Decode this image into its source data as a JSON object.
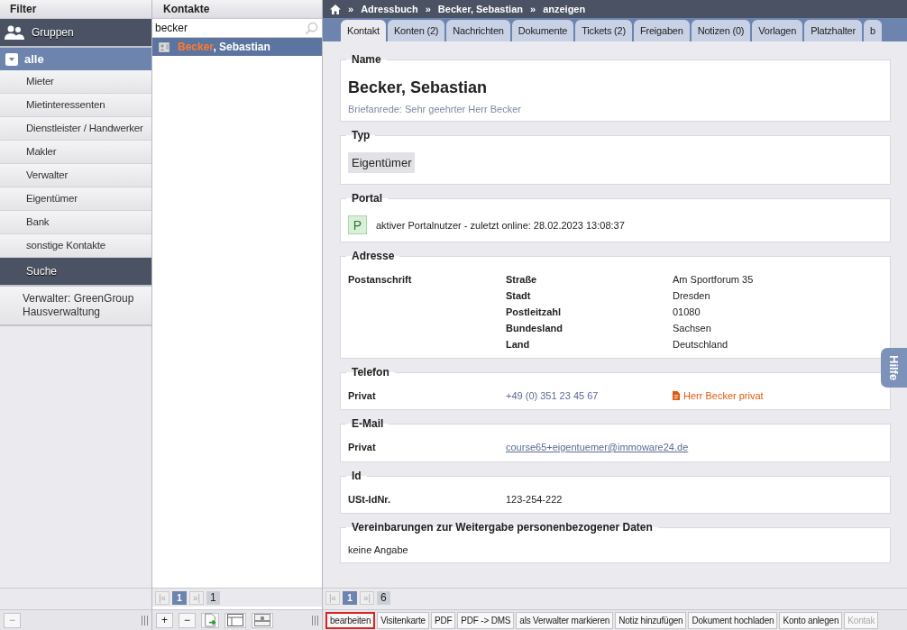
{
  "filter": {
    "title": "Filter",
    "items": [
      {
        "kind": "header",
        "label": "Gruppen"
      },
      {
        "kind": "group",
        "label": "alle",
        "expanded": true,
        "children": [
          {
            "label": "Mieter"
          },
          {
            "label": "Mietinteressenten"
          },
          {
            "label": "Dienstleister / Handwerker"
          },
          {
            "label": "Makler"
          },
          {
            "label": "Verwalter"
          },
          {
            "label": "Eigentümer"
          },
          {
            "label": "Bank"
          },
          {
            "label": "sonstige Kontakte"
          }
        ]
      },
      {
        "kind": "header",
        "label": "Suche"
      },
      {
        "kind": "entry",
        "label": "Verwalter: GreenGroup Hausverwaltung"
      }
    ],
    "toolbar": [
      "−"
    ]
  },
  "contacts": {
    "title": "Kontakte",
    "search": {
      "value": "becker"
    },
    "results": [
      {
        "match": "Becker",
        "rest": ", Sebastian",
        "selected": true
      }
    ],
    "pager": {
      "first": "|«",
      "page": "1",
      "last": "»|",
      "total": "1"
    },
    "toolbar": [
      "+",
      "−"
    ]
  },
  "detail": {
    "breadcrumb_separator": "»",
    "breadcrumb": [
      "Adressbuch",
      "Becker, Sebastian",
      "anzeigen"
    ],
    "tabs": [
      {
        "label": "Kontakt",
        "selected": true
      },
      {
        "label": "Konten (2)",
        "selected": false
      },
      {
        "label": "Nachrichten",
        "selected": false
      },
      {
        "label": "Dokumente",
        "selected": false
      },
      {
        "label": "Tickets (2)",
        "selected": false
      },
      {
        "label": "Freigaben",
        "selected": false
      },
      {
        "label": "Notizen (0)",
        "selected": false
      },
      {
        "label": "Vorlagen",
        "selected": false
      },
      {
        "label": "Platzhalter",
        "selected": false
      },
      {
        "label": "b",
        "selected": false
      }
    ],
    "sections": [
      {
        "kind": "name",
        "title": "Name",
        "name": "Becker, Sebastian",
        "salutation": "Briefanrede: Sehr geehrter Herr Becker"
      },
      {
        "kind": "type",
        "title": "Typ",
        "value": "Eigentümer"
      },
      {
        "kind": "portal",
        "title": "Portal",
        "badge": "P",
        "text": "aktiver Portalnutzer - zuletzt online: 28.02.2023 13:08:37"
      },
      {
        "kind": "address",
        "title": "Adresse",
        "label": "Postanschrift",
        "rows": [
          {
            "key": "Straße",
            "value": "Am Sportforum 35"
          },
          {
            "key": "Stadt",
            "value": "Dresden"
          },
          {
            "key": "Postleitzahl",
            "value": "01080"
          },
          {
            "key": "Bundesland",
            "value": "Sachsen"
          },
          {
            "key": "Land",
            "value": "Deutschland"
          }
        ]
      },
      {
        "kind": "phone",
        "title": "Telefon",
        "label": "Privat",
        "value": "+49 (0) 351 23 45 67",
        "note": "Herr Becker privat"
      },
      {
        "kind": "email",
        "title": "E-Mail",
        "label": "Privat",
        "value": "course65+eigentuemer@immoware24.de"
      },
      {
        "kind": "field",
        "title": "Id",
        "label": "USt-IdNr.",
        "value": "123-254-222"
      },
      {
        "kind": "text",
        "title": "Vereinbarungen zur Weitergabe personenbezogener Daten",
        "value": "keine Angabe"
      }
    ],
    "help": "Hilfe",
    "pager": {
      "first": "|«",
      "page": "1",
      "last": "»|",
      "total": "6"
    },
    "actions": [
      {
        "label": "bearbeiten",
        "focused": true,
        "disabled": false
      },
      {
        "label": "Visitenkarte",
        "focused": false,
        "disabled": false
      },
      {
        "label": "PDF",
        "focused": false,
        "disabled": false
      },
      {
        "label": "PDF -> DMS",
        "focused": false,
        "disabled": false
      },
      {
        "label": "als Verwalter markieren",
        "focused": false,
        "disabled": false
      },
      {
        "label": "Notiz hinzufügen",
        "focused": false,
        "disabled": false
      },
      {
        "label": "Dokument hochladen",
        "focused": false,
        "disabled": false
      },
      {
        "label": "Konto anlegen",
        "focused": false,
        "disabled": false
      },
      {
        "label": "Kontak",
        "focused": false,
        "disabled": true
      }
    ]
  }
}
